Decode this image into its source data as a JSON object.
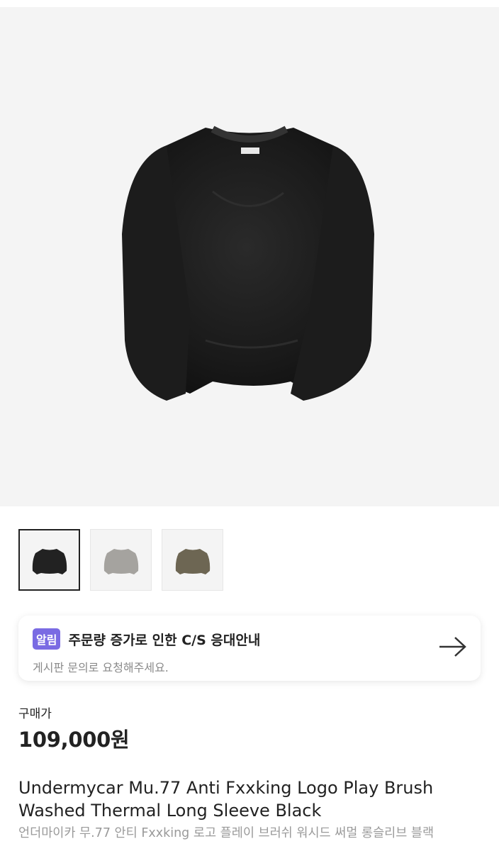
{
  "gallery": {
    "thumbnails": [
      {
        "name": "black",
        "color": "#222222",
        "selected": true
      },
      {
        "name": "grey",
        "color": "#a5a39f",
        "selected": false
      },
      {
        "name": "olive",
        "color": "#6d6653",
        "selected": false
      }
    ]
  },
  "notice": {
    "badge": "알림",
    "title": "주문량 증가로 인한 C/S 응대안내",
    "subtitle": "게시판 문의로 요청해주세요.",
    "icon": "arrow-right-icon"
  },
  "price": {
    "label": "구매가",
    "value": "109,000원"
  },
  "product": {
    "title_line1": "Undermycar Mu.77 Anti Fxxking Logo Play Brush",
    "title_line2": "Washed Thermal Long Sleeve Black",
    "subtitle": "언더마이카 무.77 안티 Fxxking 로고 플레이 브러쉬 워시드 써멀 롱슬리브 블랙"
  }
}
